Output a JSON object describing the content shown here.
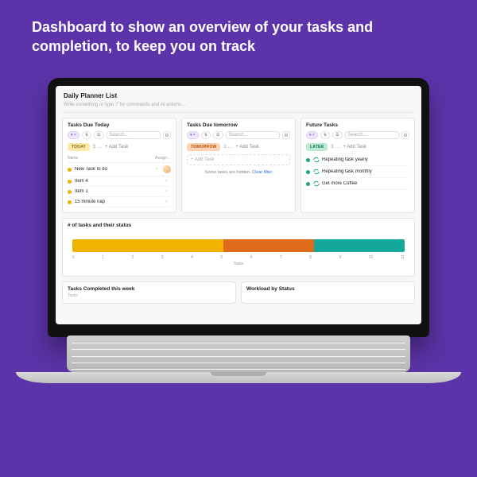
{
  "headline": "Dashboard to show an overview of your tasks and completion, to keep you on track",
  "page": {
    "title": "Daily Planner List",
    "prompt": "Write something or type '/' for commands and AI actions…"
  },
  "columns": {
    "today": {
      "title": "Tasks Due Today",
      "pill": "TODAY",
      "count": "5 …",
      "add": "+ Add Task",
      "search_placeholder": "Search…",
      "head_name": "Name",
      "head_assign": "Assign…",
      "rows": [
        {
          "name": "New Task to do",
          "avatar": true
        },
        {
          "name": "Item 4"
        },
        {
          "name": "Item 1"
        },
        {
          "name": "15 minute nap"
        }
      ]
    },
    "tomorrow": {
      "title": "Tasks Due tomorrow",
      "pill": "TOMORROW",
      "count": "1 …",
      "add": "+ Add Task",
      "ghost_add": "+  Add Task",
      "search_placeholder": "Search…",
      "hidden_text": "Some tasks are hidden.",
      "clear_filter": "Clear filter"
    },
    "future": {
      "title": "Future Tasks",
      "pill": "LATER",
      "count": "3 …",
      "add": "+ Add Task",
      "search_placeholder": "Search…",
      "rows": [
        {
          "name": "Repeating task yearly"
        },
        {
          "name": "Repeating task monthly"
        },
        {
          "name": "Get more Coffee"
        }
      ]
    }
  },
  "status_chart": {
    "title": "# of tasks and their status",
    "xlabel": "Tasks"
  },
  "bottom": {
    "left_title": "Tasks Completed this week",
    "left_sub": "Tasks",
    "right_title": "Workload by Status"
  },
  "chart_data": {
    "type": "bar",
    "title": "# of tasks and their status",
    "xlabel": "Tasks",
    "ylabel": "",
    "categories": [
      "Today",
      "Tomorrow",
      "Later"
    ],
    "values": [
      5,
      3,
      3
    ],
    "colors": [
      "#f2b200",
      "#e06a1b",
      "#14a89a"
    ],
    "xlim": [
      0,
      11
    ],
    "ticks": [
      0,
      1,
      2,
      3,
      4,
      5,
      6,
      7,
      8,
      9,
      10,
      11
    ]
  }
}
